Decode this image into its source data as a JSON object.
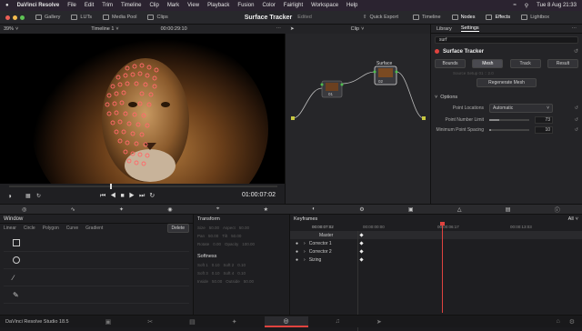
{
  "menubar": {
    "app_name": "DaVinci Resolve",
    "items": [
      "File",
      "Edit",
      "Trim",
      "Timeline",
      "Clip",
      "Mark",
      "View",
      "Playback",
      "Fusion",
      "Color",
      "Fairlight",
      "Workspace",
      "Help"
    ],
    "clock": "Tue 8 Aug 21:33"
  },
  "toolbar": {
    "left": [
      "Gallery",
      "LUTs",
      "Media Pool",
      "Clips"
    ],
    "project_title": "Surface Tracker",
    "status": "Edited",
    "quick_export": "Quick Export",
    "right": [
      "Timeline",
      "Nodes",
      "Effects",
      "Lightbox"
    ]
  },
  "viewer": {
    "zoom": "39%",
    "timeline_name": "Timeline 1",
    "timecode_top": "00:00:29:10",
    "timecode": "01:00:07:02"
  },
  "nodes": {
    "mode": "Clip",
    "node1_label": "01",
    "node2_label": "02",
    "node2_title": "Surface"
  },
  "inspector": {
    "tabs": [
      "Library",
      "Settings"
    ],
    "search_value": "surf",
    "effect_title": "Surface Tracker",
    "subtabs": [
      "Bounds",
      "Mesh",
      "Track",
      "Result"
    ],
    "faint_row": "Source Setup    01 :: 2.0",
    "regenerate_label": "Regenerate Mesh",
    "options_label": "Options",
    "point_location_label": "Point Locations",
    "point_location_value": "Automatic",
    "point_number_label": "Point Number Limit",
    "point_number_value": "73",
    "point_spacing_label": "Minimum Point Spacing",
    "point_spacing_value": "10",
    "point_number_fraction": 0.25,
    "point_spacing_fraction": 0.05
  },
  "window_panel": {
    "title": "Window",
    "tools": [
      "Linear",
      "Circle",
      "Polygon",
      "Curve",
      "Gradient"
    ],
    "delete_label": "Delete"
  },
  "transform_panel": {
    "title": "Transform",
    "rows": [
      [
        "Size",
        "50.00",
        "Aspect",
        "50.00"
      ],
      [
        "Pan",
        "50.00",
        "Tilt",
        "50.00"
      ],
      [
        "Rotate",
        "0.00",
        "Opacity",
        "100.00"
      ]
    ],
    "softness_title": "Softness",
    "soft_rows": [
      [
        "Soft 1",
        "0.10",
        "Soft 2",
        "0.10"
      ],
      [
        "Soft 3",
        "0.10",
        "Soft 4",
        "0.10"
      ],
      [
        "Inside",
        "50.00",
        "Outside",
        "50.00"
      ]
    ]
  },
  "keyframes": {
    "title": "Keyframes",
    "filter": "All",
    "timecode": "00:00:07:02",
    "ruler": [
      "00:00:00:00",
      "00:00:06:17",
      "00:00:13:03"
    ],
    "tracks": [
      "Master",
      "Corrector 1",
      "Corrector 2",
      "Sizing"
    ]
  },
  "footer": {
    "app_version": "DaVinci Resolve Studio 18.5"
  },
  "colors": {
    "accent": "#e0433f",
    "playhead": "#e0433f"
  }
}
